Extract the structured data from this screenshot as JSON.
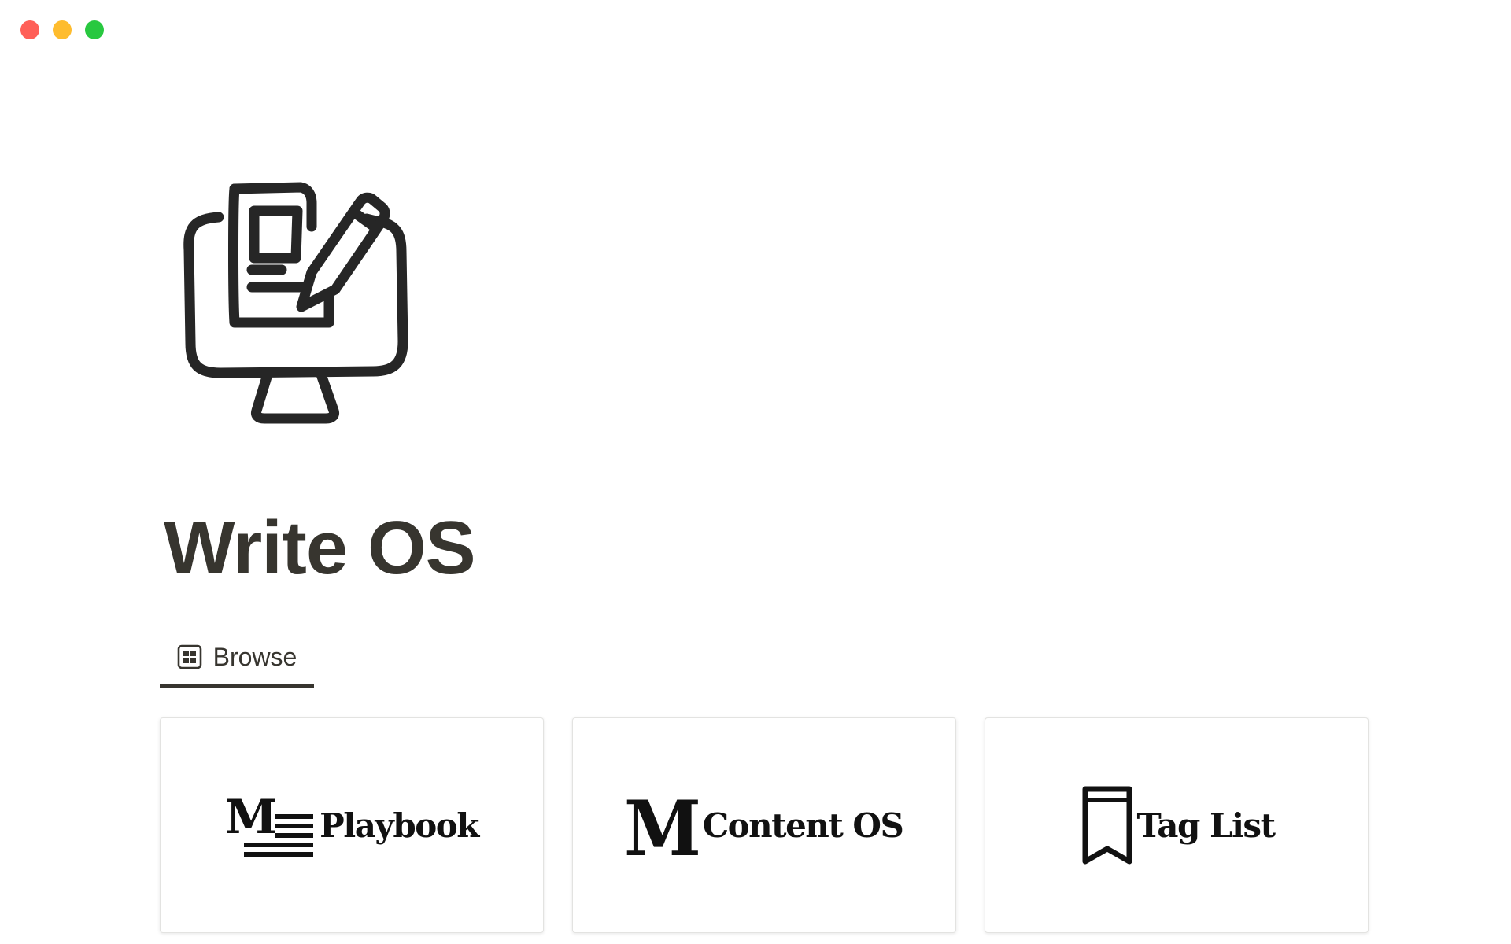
{
  "window": {
    "controls": {
      "close_color": "#ff5f57",
      "minimize_color": "#febc2e",
      "zoom_color": "#28c840"
    }
  },
  "page": {
    "icon": "monitor-with-document-and-pencil-icon",
    "title": "Write OS"
  },
  "tabs": [
    {
      "label": "Browse",
      "icon": "gallery-view-icon",
      "active": true
    }
  ],
  "cards": [
    {
      "label": "Playbook",
      "icon": "m-lines-logo-icon"
    },
    {
      "label": "Content OS",
      "icon": "m-serif-logo-icon"
    },
    {
      "label": "Tag List",
      "icon": "bookmark-icon"
    }
  ],
  "colors": {
    "text": "#37352f",
    "divider": "#e6e6e4"
  }
}
